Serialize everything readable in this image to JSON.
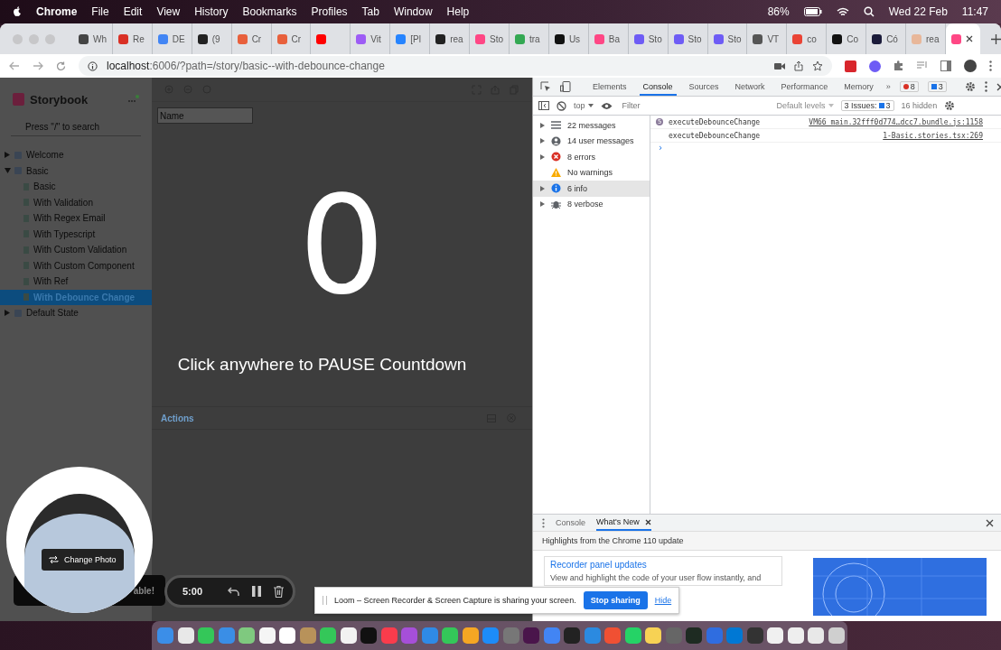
{
  "menubar": {
    "app": "Chrome",
    "menus": [
      "File",
      "Edit",
      "View",
      "History",
      "Bookmarks",
      "Profiles",
      "Tab",
      "Window",
      "Help"
    ],
    "battery": "86%",
    "date": "Wed 22 Feb",
    "time": "11:47"
  },
  "tabs": [
    {
      "title": "Wh",
      "color": "#444444",
      "selected": false
    },
    {
      "title": "Re",
      "color": "#d93025",
      "selected": false
    },
    {
      "title": "DE",
      "color": "#4285f4",
      "selected": false
    },
    {
      "title": "(9",
      "color": "#222222",
      "selected": false
    },
    {
      "title": "Cr",
      "color": "#e8603c",
      "selected": false
    },
    {
      "title": "Cr",
      "color": "#e8603c",
      "selected": false
    },
    {
      "color": "#ff0000",
      "selected": false
    },
    {
      "title": "Vit",
      "color": "#9d5cf5",
      "selected": false
    },
    {
      "title": "[Pl",
      "color": "#2684ff",
      "selected": false
    },
    {
      "title": "rea",
      "color": "#222222",
      "selected": false
    },
    {
      "title": "Sto",
      "color": "#ff4785",
      "selected": false
    },
    {
      "title": "tra",
      "color": "#34a853",
      "selected": false
    },
    {
      "title": "Us",
      "color": "#111111",
      "selected": false
    },
    {
      "title": "Ba",
      "color": "#ff4785",
      "selected": false
    },
    {
      "title": "Sto",
      "color": "#6e5cf5",
      "selected": false
    },
    {
      "title": "Sto",
      "color": "#6e5cf5",
      "selected": false
    },
    {
      "title": "Sto",
      "color": "#6e5cf5",
      "selected": false
    },
    {
      "title": "VT",
      "color": "#555555",
      "selected": false
    },
    {
      "title": "co",
      "color": "#ea4335",
      "selected": false
    },
    {
      "title": "Co",
      "color": "#111111",
      "selected": false
    },
    {
      "title": "Có",
      "color": "#1b1b3a",
      "selected": false
    },
    {
      "title": "rea",
      "color": "#e8b79a",
      "selected": false
    },
    {
      "color": "#ff4785",
      "selected": true
    }
  ],
  "address": {
    "host": "localhost",
    "path": ":6006/?path=/story/basic--with-debounce-change"
  },
  "storybook": {
    "title": "Storybook",
    "search": {
      "placeholder": "Press \"/\" to search"
    },
    "tree": [
      {
        "label": "Welcome",
        "expanded": false,
        "selected": false
      },
      {
        "label": "Basic",
        "expanded": true,
        "selected": false,
        "children": [
          {
            "label": "Basic",
            "selected": false
          },
          {
            "label": "With Validation",
            "selected": false
          },
          {
            "label": "With Regex Email",
            "selected": false
          },
          {
            "label": "With Typescript",
            "selected": false
          },
          {
            "label": "With Custom Validation",
            "selected": false
          },
          {
            "label": "With Custom Component",
            "selected": false
          },
          {
            "label": "With Ref",
            "selected": false
          },
          {
            "label": "With Debounce Change",
            "selected": true
          }
        ]
      },
      {
        "label": "Default State",
        "expanded": false,
        "selected": false
      }
    ],
    "preview": {
      "name_field": {
        "placeholder": "Name"
      },
      "countdown": "0",
      "message": "Click anywhere to PAUSE Countdown"
    },
    "addons": {
      "tab": "Actions"
    },
    "banner": "able!"
  },
  "devtools": {
    "tabs": [
      {
        "label": "Elements",
        "selected": false
      },
      {
        "label": "Console",
        "selected": true
      },
      {
        "label": "Sources",
        "selected": false
      },
      {
        "label": "Network",
        "selected": false
      },
      {
        "label": "Performance",
        "selected": false
      },
      {
        "label": "Memory",
        "selected": false
      }
    ],
    "more": "»",
    "errors": "8",
    "messages": "3",
    "toolbar": {
      "context": "top",
      "filter": {
        "placeholder": "Filter"
      },
      "levels": "Default levels",
      "issues_label": "3 Issues:",
      "issues": "3",
      "hidden": "16 hidden"
    },
    "sidebar": [
      {
        "kind": "list",
        "label": "22 messages",
        "expandable": true,
        "selected": false
      },
      {
        "kind": "user",
        "label": "14 user messages",
        "expandable": true,
        "selected": false
      },
      {
        "kind": "error",
        "label": "8 errors",
        "expandable": true,
        "selected": false
      },
      {
        "kind": "warning",
        "label": "No warnings",
        "expandable": false,
        "selected": false
      },
      {
        "kind": "info",
        "label": "6 info",
        "expandable": true,
        "selected": true
      },
      {
        "kind": "verbose",
        "label": "8 verbose",
        "expandable": true,
        "selected": false
      }
    ],
    "log": [
      {
        "count": "5",
        "text": "executeDebounceChange",
        "source": "VM66 main.32fff0d774…dcc7.bundle.js:1158"
      },
      {
        "text": "executeDebounceChange",
        "source": "1-Basic.stories.tsx:269"
      }
    ],
    "prompt": "›",
    "drawer": {
      "tabs": [
        {
          "label": "Console",
          "selected": false,
          "closable": false
        },
        {
          "label": "What's New",
          "selected": true,
          "closable": true
        }
      ],
      "heading": "Highlights from the Chrome 110 update",
      "cards": [
        {
          "title": "Recorder panel updates",
          "text": "View and highlight the code of your user flow instantly, and"
        }
      ]
    }
  },
  "loom": {
    "change_photo": "Change Photo",
    "timer": "5:00",
    "notice": "Loom – Screen Recorder & Screen Capture is sharing your screen.",
    "stop": "Stop sharing",
    "hide": "Hide"
  },
  "dock": [
    {
      "color": "#3b8ee8"
    },
    {
      "color": "#e8e8e8"
    },
    {
      "color": "#34c759"
    },
    {
      "color": "#3a8ee6"
    },
    {
      "color": "#7fc97f"
    },
    {
      "color": "#f5f5f5"
    },
    {
      "color": "#ffffff"
    },
    {
      "color": "#b8925a"
    },
    {
      "color": "#34c759"
    },
    {
      "color": "#f2f2f2"
    },
    {
      "color": "#111111"
    },
    {
      "color": "#fa3c4c"
    },
    {
      "color": "#a64fd8"
    },
    {
      "color": "#2f8ae6"
    },
    {
      "color": "#34c759"
    },
    {
      "color": "#f5a623"
    },
    {
      "color": "#1d8cf8"
    },
    {
      "color": "#777777"
    },
    {
      "color": "#4a154b"
    },
    {
      "color": "#4285f4"
    },
    {
      "color": "#222222"
    },
    {
      "color": "#2b8ae0"
    },
    {
      "color": "#f05033"
    },
    {
      "color": "#25d366"
    },
    {
      "color": "#f7d254"
    },
    {
      "color": "#666666"
    },
    {
      "color": "#1e2b22"
    },
    {
      "color": "#2f6de0"
    },
    {
      "color": "#0078d4"
    },
    {
      "color": "#333333"
    },
    {
      "color": "#f0f0f0"
    },
    {
      "color": "#eeeeee"
    },
    {
      "color": "#e8e8e8"
    },
    {
      "color": "#cfcfcf"
    }
  ]
}
